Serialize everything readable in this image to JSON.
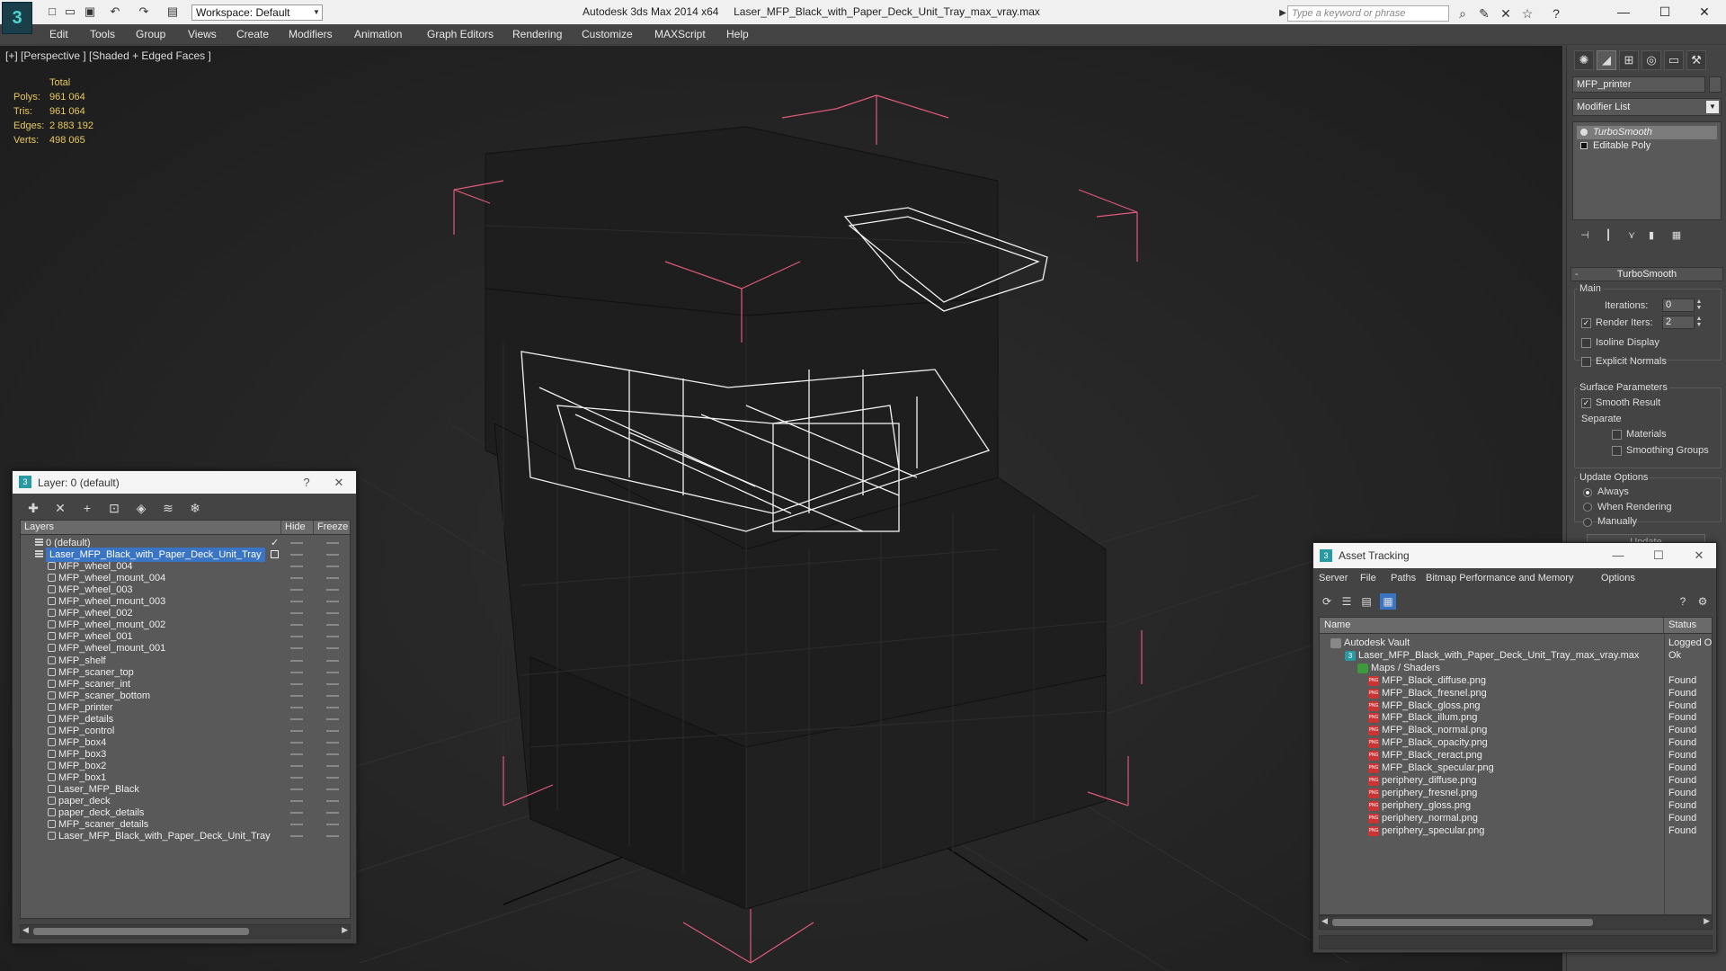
{
  "app": {
    "title": "Autodesk 3ds Max  2014 x64",
    "file": "Laser_MFP_Black_with_Paper_Deck_Unit_Tray_max_vray.max",
    "workspace": "Workspace: Default",
    "search_placeholder": "Type a keyword or phrase"
  },
  "menu": [
    "Edit",
    "Tools",
    "Group",
    "Views",
    "Create",
    "Modifiers",
    "Animation",
    "Graph Editors",
    "Rendering",
    "Customize",
    "MAXScript",
    "Help"
  ],
  "viewport": {
    "label": "[+] [Perspective ] [Shaded + Edged Faces ]",
    "stats_header": "Total",
    "stats": [
      {
        "label": "Polys:",
        "value": "961 064"
      },
      {
        "label": "Tris:",
        "value": "961 064"
      },
      {
        "label": "Edges:",
        "value": "2 883 192"
      },
      {
        "label": "Verts:",
        "value": "498 065"
      }
    ]
  },
  "command_panel": {
    "object_name": "MFP_printer",
    "modifier_list": "Modifier List",
    "stack": [
      "TurboSmooth",
      "Editable Poly"
    ],
    "rollout": "TurboSmooth",
    "main_group": "Main",
    "iterations_label": "Iterations:",
    "iterations_value": "0",
    "render_iters_label": "Render Iters:",
    "render_iters_value": "2",
    "isoline": "Isoline Display",
    "explicit_normals": "Explicit Normals",
    "surface_group": "Surface Parameters",
    "smooth_result": "Smooth Result",
    "separate": "Separate",
    "materials": "Materials",
    "smoothing_groups": "Smoothing Groups",
    "update_group": "Update Options",
    "always": "Always",
    "when_rendering": "When Rendering",
    "manually": "Manually",
    "update_button": "Update"
  },
  "layer_window": {
    "title": "Layer: 0 (default)",
    "col_layers": "Layers",
    "col_hide": "Hide",
    "col_freeze": "Freeze",
    "layers": [
      {
        "name": "0 (default)",
        "level": 1,
        "type": "layer"
      },
      {
        "name": "Laser_MFP_Black_with_Paper_Deck_Unit_Tray",
        "level": 1,
        "type": "layer",
        "selected": true
      },
      {
        "name": "MFP_wheel_004",
        "level": 2,
        "type": "object"
      },
      {
        "name": "MFP_wheel_mount_004",
        "level": 2,
        "type": "object"
      },
      {
        "name": "MFP_wheel_003",
        "level": 2,
        "type": "object"
      },
      {
        "name": "MFP_wheel_mount_003",
        "level": 2,
        "type": "object"
      },
      {
        "name": "MFP_wheel_002",
        "level": 2,
        "type": "object"
      },
      {
        "name": "MFP_wheel_mount_002",
        "level": 2,
        "type": "object"
      },
      {
        "name": "MFP_wheel_001",
        "level": 2,
        "type": "object"
      },
      {
        "name": "MFP_wheel_mount_001",
        "level": 2,
        "type": "object"
      },
      {
        "name": "MFP_shelf",
        "level": 2,
        "type": "object"
      },
      {
        "name": "MFP_scaner_top",
        "level": 2,
        "type": "object"
      },
      {
        "name": "MFP_scaner_int",
        "level": 2,
        "type": "object"
      },
      {
        "name": "MFP_scaner_bottom",
        "level": 2,
        "type": "object"
      },
      {
        "name": "MFP_printer",
        "level": 2,
        "type": "object"
      },
      {
        "name": "MFP_details",
        "level": 2,
        "type": "object"
      },
      {
        "name": "MFP_control",
        "level": 2,
        "type": "object"
      },
      {
        "name": "MFP_box4",
        "level": 2,
        "type": "object"
      },
      {
        "name": "MFP_box3",
        "level": 2,
        "type": "object"
      },
      {
        "name": "MFP_box2",
        "level": 2,
        "type": "object"
      },
      {
        "name": "MFP_box1",
        "level": 2,
        "type": "object"
      },
      {
        "name": "Laser_MFP_Black",
        "level": 2,
        "type": "object"
      },
      {
        "name": "paper_deck",
        "level": 2,
        "type": "object"
      },
      {
        "name": "paper_deck_details",
        "level": 2,
        "type": "object"
      },
      {
        "name": "MFP_scaner_details",
        "level": 2,
        "type": "object"
      },
      {
        "name": "Laser_MFP_Black_with_Paper_Deck_Unit_Tray",
        "level": 2,
        "type": "object"
      }
    ]
  },
  "asset_window": {
    "title": "Asset Tracking",
    "menu": [
      "Server",
      "File",
      "Paths",
      "Bitmap Performance and Memory",
      "Options"
    ],
    "col_name": "Name",
    "col_status": "Status",
    "rows": [
      {
        "name": "Autodesk Vault",
        "status": "Logged Ou",
        "level": 1,
        "icon": "vault"
      },
      {
        "name": "Laser_MFP_Black_with_Paper_Deck_Unit_Tray_max_vray.max",
        "status": "Ok",
        "level": 2,
        "icon": "max"
      },
      {
        "name": "Maps / Shaders",
        "status": "",
        "level": 3,
        "icon": "maps"
      },
      {
        "name": "MFP_Black_diffuse.png",
        "status": "Found",
        "level": 4,
        "icon": "png"
      },
      {
        "name": "MFP_Black_fresnel.png",
        "status": "Found",
        "level": 4,
        "icon": "png"
      },
      {
        "name": "MFP_Black_gloss.png",
        "status": "Found",
        "level": 4,
        "icon": "png"
      },
      {
        "name": "MFP_Black_illum.png",
        "status": "Found",
        "level": 4,
        "icon": "png"
      },
      {
        "name": "MFP_Black_normal.png",
        "status": "Found",
        "level": 4,
        "icon": "png"
      },
      {
        "name": "MFP_Black_opacity.png",
        "status": "Found",
        "level": 4,
        "icon": "png"
      },
      {
        "name": "MFP_Black_reract.png",
        "status": "Found",
        "level": 4,
        "icon": "png"
      },
      {
        "name": "MFP_Black_specular.png",
        "status": "Found",
        "level": 4,
        "icon": "png"
      },
      {
        "name": "periphery_diffuse.png",
        "status": "Found",
        "level": 4,
        "icon": "png"
      },
      {
        "name": "periphery_fresnel.png",
        "status": "Found",
        "level": 4,
        "icon": "png"
      },
      {
        "name": "periphery_gloss.png",
        "status": "Found",
        "level": 4,
        "icon": "png"
      },
      {
        "name": "periphery_normal.png",
        "status": "Found",
        "level": 4,
        "icon": "png"
      },
      {
        "name": "periphery_specular.png",
        "status": "Found",
        "level": 4,
        "icon": "png"
      }
    ]
  },
  "colors": {
    "stats": "#e8c95f",
    "selection": "#3a74c4",
    "bbox": "#e05a7a"
  }
}
